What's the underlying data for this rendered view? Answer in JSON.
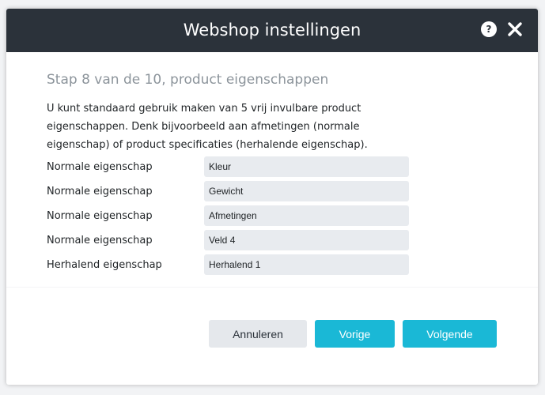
{
  "dialog": {
    "title": "Webshop instellingen",
    "help_label": "?",
    "close_label": "close"
  },
  "step": {
    "subtitle": "Stap 8 van de 10, product eigenschappen",
    "description": "U kunt standaard gebruik maken van 5 vrij invulbare product eigenschappen. Denk bijvoorbeeld aan afmetingen (normale eigenschap) of product specificaties (herhalende eigenschap)."
  },
  "properties": [
    {
      "label": "Normale eigenschap",
      "value": "Kleur"
    },
    {
      "label": "Normale eigenschap",
      "value": "Gewicht"
    },
    {
      "label": "Normale eigenschap",
      "value": "Afmetingen"
    },
    {
      "label": "Normale eigenschap",
      "value": "Veld 4"
    },
    {
      "label": "Herhalend eigenschap",
      "value": "Herhalend 1"
    }
  ],
  "buttons": {
    "cancel": "Annuleren",
    "previous": "Vorige",
    "next": "Volgende"
  },
  "colors": {
    "titlebar": "#2b323a",
    "accent": "#1ab8d6",
    "field_bg": "#e8ebef"
  }
}
